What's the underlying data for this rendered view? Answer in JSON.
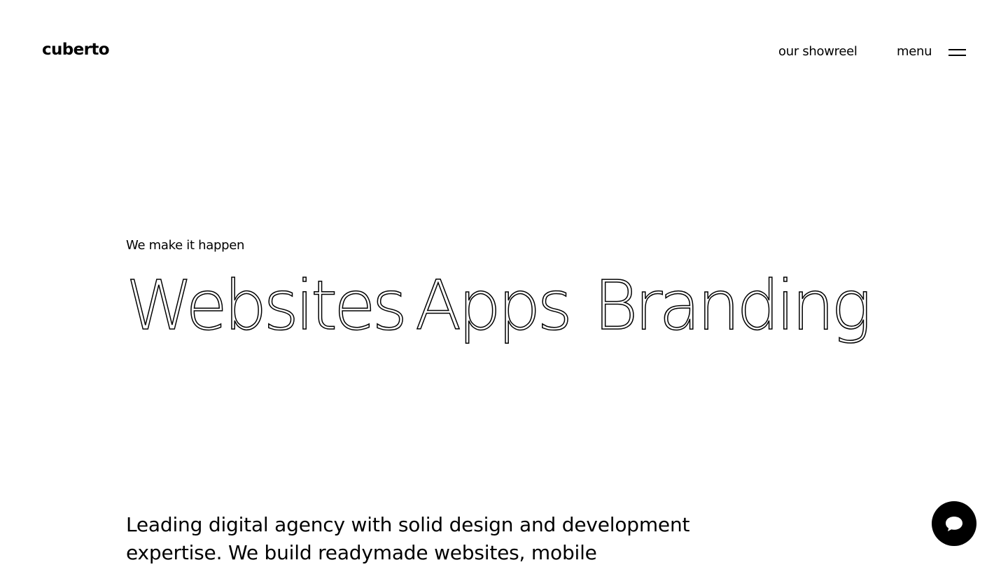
{
  "header": {
    "logo": "cuberto",
    "showreel_label": "our showreel",
    "menu_label": "menu"
  },
  "hero": {
    "eyebrow": "We make it happen",
    "services": [
      "Websites",
      "Apps",
      "Branding"
    ]
  },
  "intro": {
    "text": "Leading digital agency with solid design and development expertise. We build readymade websites, mobile"
  },
  "icons": {
    "menu": "hamburger-icon",
    "chat": "chat-bubble-icon"
  },
  "colors": {
    "background": "#ffffff",
    "text": "#000000",
    "chat_button": "#000000"
  }
}
